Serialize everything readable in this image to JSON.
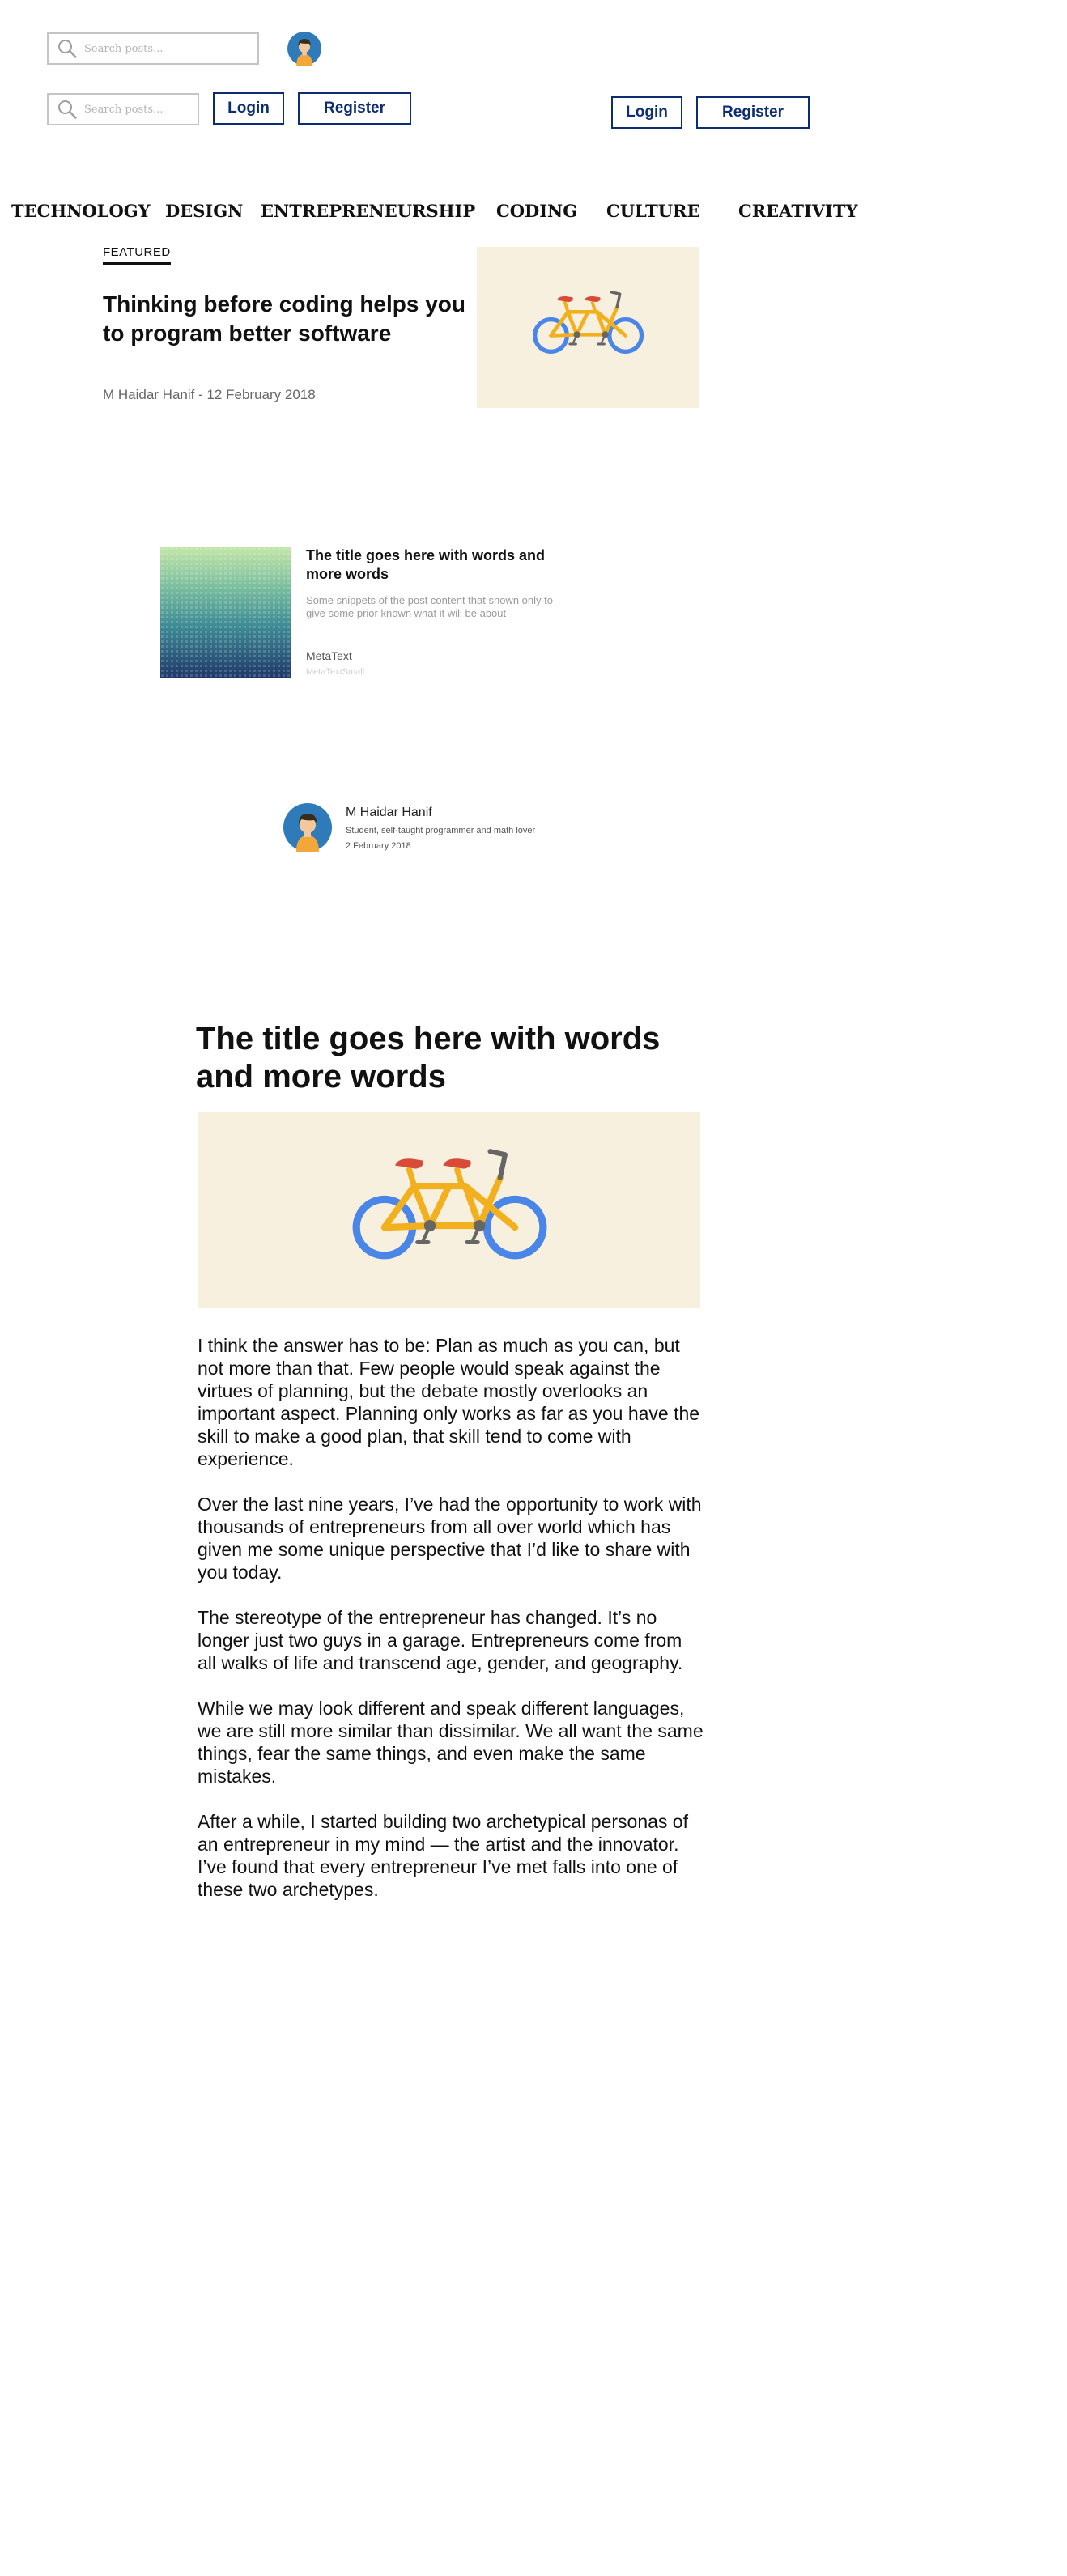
{
  "header": {
    "search_placeholder": "Search posts...",
    "login_label": "Login",
    "register_label": "Register"
  },
  "nav": {
    "items": [
      "TECHNOLOGY",
      "DESIGN",
      "ENTREPRENEURSHIP",
      "CODING",
      "CULTURE",
      "CREATIVITY"
    ]
  },
  "featured": {
    "label": "FEATURED",
    "title": "Thinking before coding helps you to program better software",
    "meta": "M Haidar Hanif - 12 February 2018"
  },
  "card": {
    "title": "The title goes here with words and more words",
    "snippet": "Some snippets of the post content that shown only to give some prior known what it will be about",
    "meta": "MetaText",
    "meta_small": "MetaTextSmall"
  },
  "author": {
    "name": "M Haidar Hanif",
    "bio": "Student, self-taught programmer and math lover",
    "date": "2 February 2018"
  },
  "article": {
    "title": "The title goes here with words and more words",
    "paragraphs": [
      "I think the answer has to be: Plan as much as you can, but not more than that. Few people would speak against the virtues of planning, but the debate mostly overlooks an important aspect. Planning only works as far as you have the skill to make a good plan, that skill tend to come with experience.",
      "Over the last nine years, I’ve had the opportunity to work with thousands of entrepreneurs from all over world which has given me some unique perspective that I’d like to share with you today.",
      "The stereotype of the entrepreneur has changed. It’s no longer just two guys in a garage. Entrepreneurs come from all walks of life and transcend age, gender, and geography.",
      "While we may look different and speak different languages, we are still more similar than dissimilar. We all want the same things, fear the same things, and even make the same mistakes.",
      "After a while, I started building two archetypical personas of an entrepreneur in my mind — the artist and the innovator. I’ve found that every entrepreneur I’ve met falls into one of these two archetypes."
    ]
  },
  "icons": {
    "search": "search-icon",
    "avatar": "avatar-icon",
    "bicycle": "tandem-bicycle-illustration"
  },
  "colors": {
    "brand_blue": "#0d2d73",
    "avatar_bg": "#2f7ab8",
    "image_bg": "#f8f0de"
  }
}
